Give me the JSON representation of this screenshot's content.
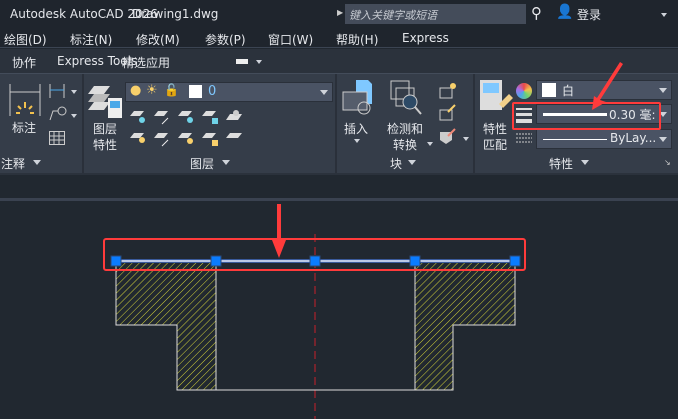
{
  "title": {
    "app": "Autodesk AutoCAD 2026",
    "file": "Drawing1.dwg",
    "search_placeholder": "键入关键字或短语",
    "login": "登录"
  },
  "menu": [
    "绘图(D)",
    "标注(N)",
    "修改(M)",
    "参数(P)",
    "窗口(W)",
    "帮助(H)",
    "Express"
  ],
  "tabs": [
    "协作",
    "Express Tools",
    "精选应用"
  ],
  "ribbon": {
    "annotation": {
      "dim_label": "标注",
      "panel": "注释"
    },
    "layers": {
      "props_label": [
        "图层",
        "特性"
      ],
      "current_layer": "0",
      "panel": "图层"
    },
    "block": {
      "insert": "插入",
      "detect": [
        "检测和",
        "转换"
      ],
      "panel": "块"
    },
    "properties": {
      "match": [
        "特性",
        "匹配"
      ],
      "color": "白",
      "lineweight": "0.30 毫:",
      "linetype": "ByLay...",
      "panel": "特性"
    }
  },
  "colors": {
    "grip": "#0a7cff",
    "highlight": "#ff3b3b",
    "hatch": "#d4d43a",
    "centerline": "#c8202a"
  }
}
